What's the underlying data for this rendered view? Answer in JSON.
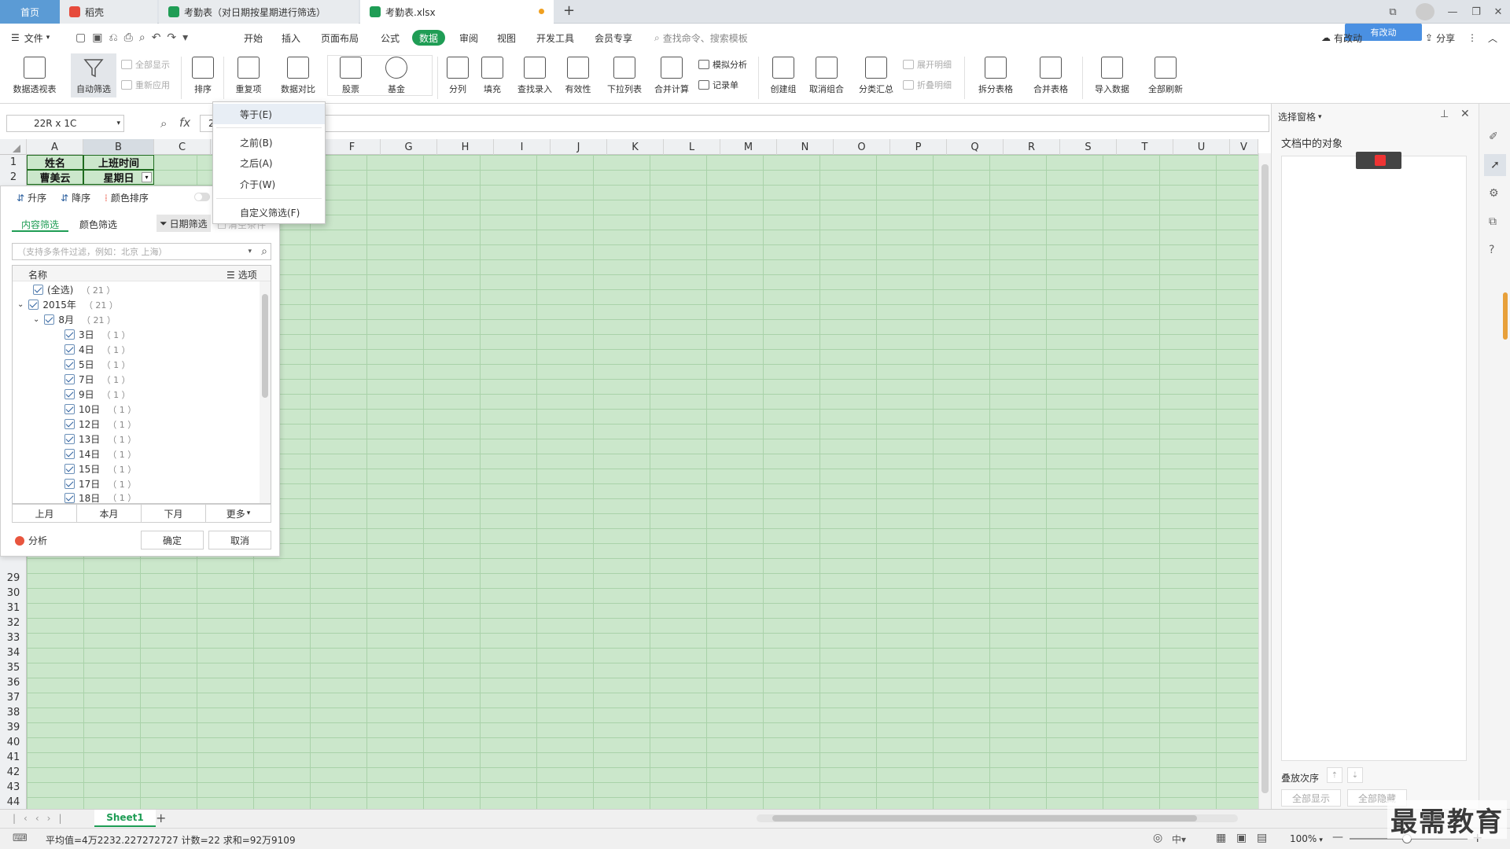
{
  "tabs": {
    "home": "首页",
    "daoke": "稻壳",
    "doc1": "考勤表（对日期按星期进行筛选）",
    "doc2": "考勤表.xlsx",
    "new_tab": "+"
  },
  "menubar": {
    "file": "文件",
    "items": [
      "开始",
      "插入",
      "页面布局",
      "公式",
      "数据",
      "审阅",
      "视图",
      "开发工具",
      "会员专享"
    ],
    "search_placeholder": "查找命令、搜索模板",
    "sync": "有改动",
    "share": "分享",
    "cloud_badge": "有改动"
  },
  "ribbon": {
    "pivot": "数据透视表",
    "autofilter": "自动筛选",
    "show_all": "全部显示",
    "reapply": "重新应用",
    "sort": "排序",
    "duplicates": "重复项",
    "compare": "数据对比",
    "stock": "股票",
    "fund": "基金",
    "split": "分列",
    "fill": "填充",
    "lookup": "查找录入",
    "validity": "有效性",
    "dropdown": "下拉列表",
    "merge_calc": "合并计算",
    "simulate": "模拟分析",
    "record": "记录单",
    "create_group": "创建组",
    "ungroup": "取消组合",
    "subtotal": "分类汇总",
    "expand": "展开明细",
    "collapse": "折叠明细",
    "split_table": "拆分表格",
    "merge_table": "合并表格",
    "import": "导入数据",
    "refresh_all": "全部刷新"
  },
  "formula": {
    "namebox": "22R x 1C",
    "fx": "fx",
    "value": "2"
  },
  "columns": [
    "A",
    "B",
    "C",
    "D",
    "E",
    "F",
    "G",
    "H",
    "I",
    "J",
    "K",
    "L",
    "M",
    "N",
    "O",
    "P",
    "Q",
    "R",
    "S",
    "T",
    "U",
    "V"
  ],
  "rows_top": [
    "1",
    "2"
  ],
  "rows_bottom": [
    "29",
    "30",
    "31",
    "32",
    "33",
    "34",
    "35",
    "36",
    "37",
    "38",
    "39",
    "40",
    "41",
    "42",
    "43",
    "44",
    "45",
    "46"
  ],
  "cells": {
    "a1": "姓名",
    "b1": "上班时间",
    "a2": "曹美云",
    "b2": "星期日"
  },
  "filter": {
    "asc": "升序",
    "desc": "降序",
    "color_sort": "颜色排序",
    "tab_content": "内容筛选",
    "tab_color": "颜色筛选",
    "date_filter": "日期筛选",
    "clear": "清空条件",
    "search_placeholder": "（支持多条件过滤，例如：北京 上海）",
    "col_name": "名称",
    "options": "选项",
    "items": [
      {
        "label": "(全选)",
        "count": "（ 21 ）"
      },
      {
        "label": "2015年",
        "count": "（ 21 ）"
      },
      {
        "label": "8月",
        "count": "（ 21 ）"
      },
      {
        "label": "3日",
        "count": "（ 1 ）"
      },
      {
        "label": "4日",
        "count": "（ 1 ）"
      },
      {
        "label": "5日",
        "count": "（ 1 ）"
      },
      {
        "label": "7日",
        "count": "（ 1 ）"
      },
      {
        "label": "9日",
        "count": "（ 1 ）"
      },
      {
        "label": "10日",
        "count": "（ 1 ）"
      },
      {
        "label": "12日",
        "count": "（ 1 ）"
      },
      {
        "label": "13日",
        "count": "（ 1 ）"
      },
      {
        "label": "14日",
        "count": "（ 1 ）"
      },
      {
        "label": "15日",
        "count": "（ 1 ）"
      },
      {
        "label": "17日",
        "count": "（ 1 ）"
      },
      {
        "label": "18日",
        "count": "（ 1 ）"
      }
    ],
    "prev_month": "上月",
    "this_month": "本月",
    "next_month": "下月",
    "more": "更多",
    "analysis": "分析",
    "ok": "确定",
    "cancel": "取消"
  },
  "date_menu": {
    "equals": "等于(E)",
    "before": "之前(B)",
    "after": "之后(A)",
    "between": "介于(W)",
    "custom": "自定义筛选(F)"
  },
  "right_pane": {
    "title": "选择窗格",
    "objects_label": "文档中的对象",
    "stack_order": "叠放次序",
    "show_all": "全部显示",
    "hide_all": "全部隐藏"
  },
  "sheetbar": {
    "sheet": "Sheet1",
    "add": "+"
  },
  "status": {
    "summary": "平均值=4万2232.227272727  计数=22  求和=92万9109",
    "zoom": "100%"
  },
  "watermark": "最需教育",
  "colors": {
    "accent": "#1f9d55",
    "tab_home": "#5b9bd5",
    "cell_fill": "#cbe7cb"
  }
}
